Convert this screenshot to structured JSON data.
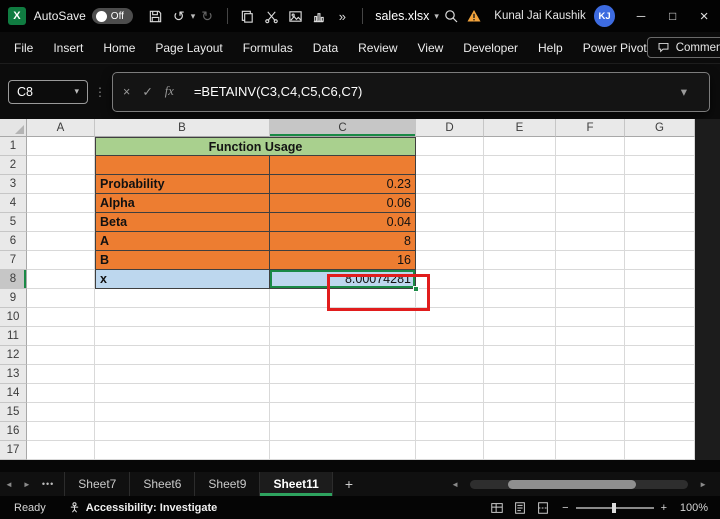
{
  "title_bar": {
    "autosave_label": "AutoSave",
    "autosave_state": "Off",
    "filename": "sales.xlsx",
    "user_name": "Kunal Jai Kaushik",
    "user_initials": "KJ"
  },
  "menu": {
    "items": [
      "File",
      "Insert",
      "Home",
      "Page Layout",
      "Formulas",
      "Data",
      "Review",
      "View",
      "Developer",
      "Help",
      "Power Pivot"
    ],
    "comments_label": "Comments"
  },
  "formula_bar": {
    "cell_ref": "C8",
    "formula": "=BETAINV(C3,C4,C5,C6,C7)"
  },
  "grid": {
    "columns": [
      "A",
      "B",
      "C",
      "D",
      "E",
      "F",
      "G"
    ],
    "rows": [
      "1",
      "2",
      "3",
      "4",
      "5",
      "6",
      "7",
      "8",
      "9",
      "10",
      "11",
      "12",
      "13",
      "14",
      "15",
      "16",
      "17"
    ],
    "selected_column": "C",
    "selected_row": "8"
  },
  "table": {
    "title": "Function Usage",
    "entries": [
      {
        "row": 3,
        "label": "Probability",
        "value": "0.23"
      },
      {
        "row": 4,
        "label": "Alpha",
        "value": "0.06"
      },
      {
        "row": 5,
        "label": "Beta",
        "value": "0.04"
      },
      {
        "row": 6,
        "label": "A",
        "value": "8"
      },
      {
        "row": 7,
        "label": "B",
        "value": "16"
      },
      {
        "row": 8,
        "label": "x",
        "value": "8.00074281"
      }
    ]
  },
  "tabs": {
    "names": [
      "Sheet7",
      "Sheet6",
      "Sheet9",
      "Sheet11"
    ],
    "active": "Sheet11"
  },
  "status_bar": {
    "ready": "Ready",
    "accessibility": "Accessibility: Investigate",
    "zoom": "100%"
  },
  "colors": {
    "header_green": "#a9d08e",
    "table_orange": "#ed7d31",
    "highlight_blue": "#bdd7ee",
    "annotation_red": "#e11d1d",
    "selection_green": "#1a8a46",
    "active_tab_accent": "#2ea35f",
    "avatar_blue": "#3d6be0"
  },
  "icons": {
    "logo_letter": "X",
    "dropdown": "▾",
    "undo": "↺",
    "redo": "↻",
    "more_commands": "»",
    "ellipsis_v": "⋮",
    "cancel": "×",
    "check": "✓",
    "fx": "fx",
    "nav_left": "◄",
    "nav_right": "►",
    "tab_overflow": "•••",
    "add_sheet": "+",
    "minimize": "─",
    "maximize": "□",
    "close": "×",
    "zoom_out": "−",
    "zoom_in": "+"
  }
}
